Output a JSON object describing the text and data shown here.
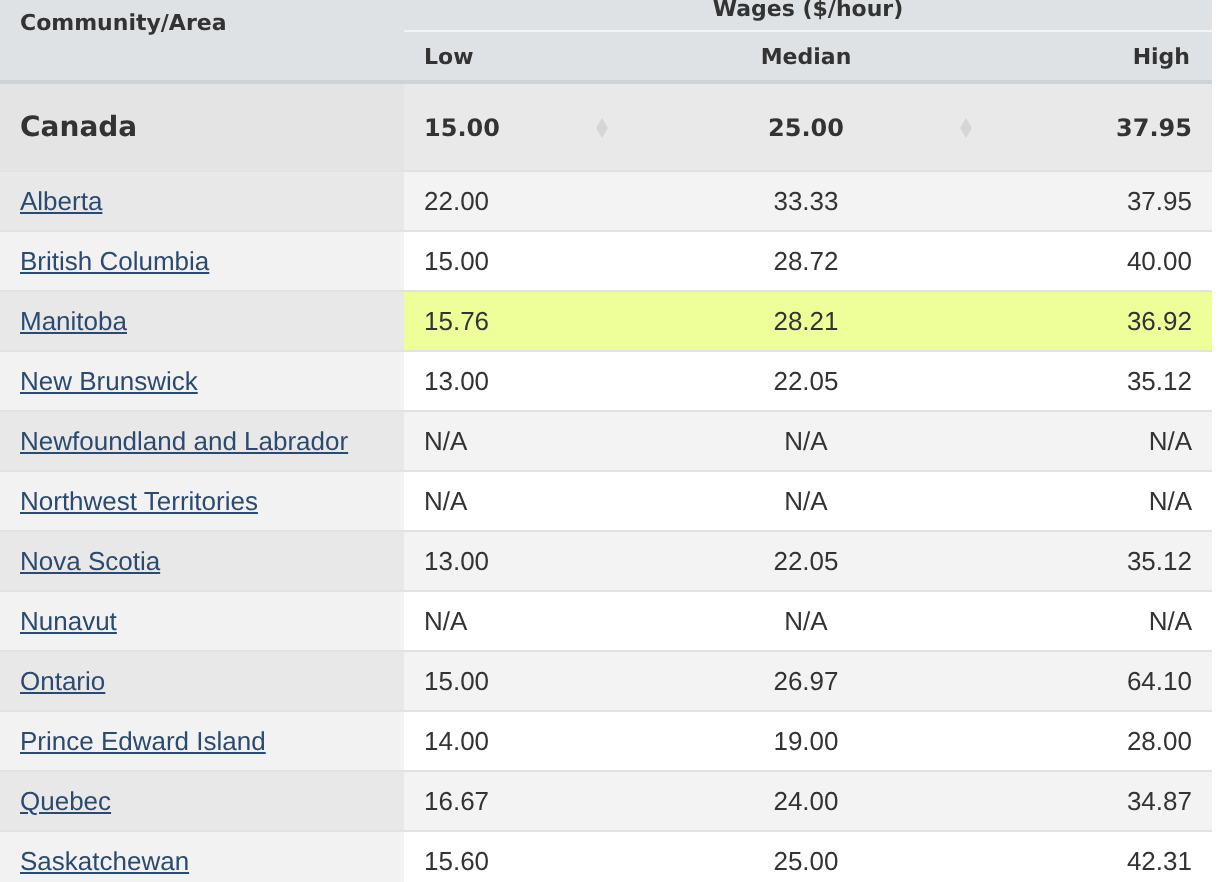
{
  "table": {
    "area_header": "Community/Area",
    "group_header": "Wages ($/hour)",
    "columns": [
      "Low",
      "Median",
      "High"
    ],
    "summary_row": {
      "area": "Canada",
      "values": [
        "15.00",
        "25.00",
        "37.95"
      ]
    },
    "rows": [
      {
        "area": "Alberta",
        "values": [
          "22.00",
          "33.33",
          "37.95"
        ],
        "selected": false
      },
      {
        "area": "British Columbia",
        "values": [
          "15.00",
          "28.72",
          "40.00"
        ],
        "selected": false
      },
      {
        "area": "Manitoba",
        "values": [
          "15.76",
          "28.21",
          "36.92"
        ],
        "selected": true
      },
      {
        "area": "New Brunswick",
        "values": [
          "13.00",
          "22.05",
          "35.12"
        ],
        "selected": false
      },
      {
        "area": "Newfoundland and Labrador",
        "values": [
          "N/A",
          "N/A",
          "N/A"
        ],
        "selected": false
      },
      {
        "area": "Northwest Territories",
        "values": [
          "N/A",
          "N/A",
          "N/A"
        ],
        "selected": false
      },
      {
        "area": "Nova Scotia",
        "values": [
          "13.00",
          "22.05",
          "35.12"
        ],
        "selected": false
      },
      {
        "area": "Nunavut",
        "values": [
          "N/A",
          "N/A",
          "N/A"
        ],
        "selected": false
      },
      {
        "area": "Ontario",
        "values": [
          "15.00",
          "26.97",
          "64.10"
        ],
        "selected": false
      },
      {
        "area": "Prince Edward Island",
        "values": [
          "14.00",
          "19.00",
          "28.00"
        ],
        "selected": false
      },
      {
        "area": "Quebec",
        "values": [
          "16.67",
          "24.00",
          "34.87"
        ],
        "selected": false
      },
      {
        "area": "Saskatchewan",
        "values": [
          "15.60",
          "25.00",
          "42.31"
        ],
        "selected": false
      }
    ]
  }
}
